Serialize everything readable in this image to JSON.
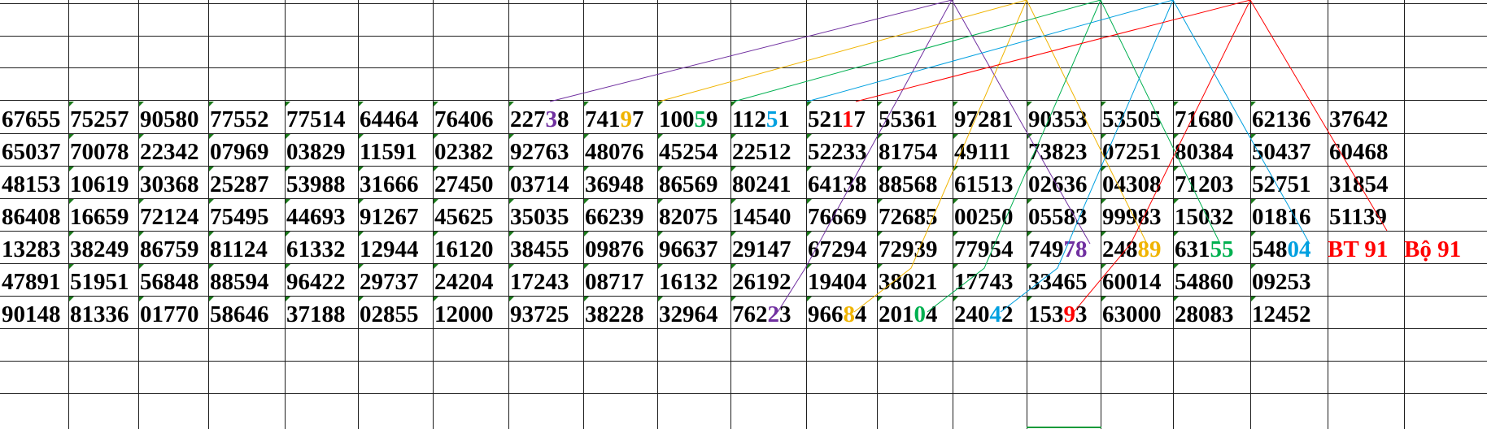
{
  "colors": {
    "black": "#000000",
    "purple": "#7030a0",
    "gold": "#f0b400",
    "green": "#00b050",
    "blue": "#00a0e0",
    "red": "#ff0000"
  },
  "rows": [
    [
      [
        {
          "t": "67655"
        }
      ],
      [
        {
          "t": "75257"
        }
      ],
      [
        {
          "t": "90580"
        }
      ],
      [
        {
          "t": "77552"
        }
      ],
      [
        {
          "t": "77514"
        }
      ],
      [
        {
          "t": "64464"
        }
      ],
      [
        {
          "t": "76406"
        }
      ],
      [
        {
          "t": "227"
        },
        {
          "t": "3",
          "c": "purple"
        },
        {
          "t": "8"
        }
      ],
      [
        {
          "t": "741"
        },
        {
          "t": "9",
          "c": "gold"
        },
        {
          "t": "7"
        }
      ],
      [
        {
          "t": "100"
        },
        {
          "t": "5",
          "c": "green"
        },
        {
          "t": "9"
        }
      ],
      [
        {
          "t": "112"
        },
        {
          "t": "5",
          "c": "blue"
        },
        {
          "t": "1"
        }
      ],
      [
        {
          "t": "521"
        },
        {
          "t": "1",
          "c": "red"
        },
        {
          "t": "7"
        }
      ],
      [
        {
          "t": "55361"
        }
      ],
      [
        {
          "t": "97281"
        }
      ],
      [
        {
          "t": "90353"
        }
      ],
      [
        {
          "t": "53505"
        }
      ],
      [
        {
          "t": "71680"
        }
      ],
      [
        {
          "t": "62136"
        }
      ],
      [
        {
          "t": "37642"
        }
      ]
    ],
    [
      [
        {
          "t": "65037"
        }
      ],
      [
        {
          "t": "70078"
        }
      ],
      [
        {
          "t": "22342"
        }
      ],
      [
        {
          "t": "07969"
        }
      ],
      [
        {
          "t": "03829"
        }
      ],
      [
        {
          "t": "11591"
        }
      ],
      [
        {
          "t": "02382"
        }
      ],
      [
        {
          "t": "92763"
        }
      ],
      [
        {
          "t": "48076"
        }
      ],
      [
        {
          "t": "45254"
        }
      ],
      [
        {
          "t": "22512"
        }
      ],
      [
        {
          "t": "52233"
        }
      ],
      [
        {
          "t": "81754"
        }
      ],
      [
        {
          "t": "49111"
        }
      ],
      [
        {
          "t": "73823"
        }
      ],
      [
        {
          "t": "07251"
        }
      ],
      [
        {
          "t": "80384"
        }
      ],
      [
        {
          "t": "50437"
        }
      ],
      [
        {
          "t": "60468"
        }
      ]
    ],
    [
      [
        {
          "t": "48153"
        }
      ],
      [
        {
          "t": "10619"
        }
      ],
      [
        {
          "t": "30368"
        }
      ],
      [
        {
          "t": "25287"
        }
      ],
      [
        {
          "t": "53988"
        }
      ],
      [
        {
          "t": "31666"
        }
      ],
      [
        {
          "t": "27450"
        }
      ],
      [
        {
          "t": "03714"
        }
      ],
      [
        {
          "t": "36948"
        }
      ],
      [
        {
          "t": "86569"
        }
      ],
      [
        {
          "t": "80241"
        }
      ],
      [
        {
          "t": "64138"
        }
      ],
      [
        {
          "t": "88568"
        }
      ],
      [
        {
          "t": "61513"
        }
      ],
      [
        {
          "t": "02636"
        }
      ],
      [
        {
          "t": "04308"
        }
      ],
      [
        {
          "t": "71203"
        }
      ],
      [
        {
          "t": "52751"
        }
      ],
      [
        {
          "t": "31854"
        }
      ]
    ],
    [
      [
        {
          "t": "86408"
        }
      ],
      [
        {
          "t": "16659"
        }
      ],
      [
        {
          "t": "72124"
        }
      ],
      [
        {
          "t": "75495"
        }
      ],
      [
        {
          "t": "44693"
        }
      ],
      [
        {
          "t": "91267"
        }
      ],
      [
        {
          "t": "45625"
        }
      ],
      [
        {
          "t": "35035"
        }
      ],
      [
        {
          "t": "66239"
        }
      ],
      [
        {
          "t": "82075"
        }
      ],
      [
        {
          "t": "14540"
        }
      ],
      [
        {
          "t": "76669"
        }
      ],
      [
        {
          "t": "72685"
        }
      ],
      [
        {
          "t": "00250"
        }
      ],
      [
        {
          "t": "05583"
        }
      ],
      [
        {
          "t": "99983"
        }
      ],
      [
        {
          "t": "15032"
        }
      ],
      [
        {
          "t": "01816"
        }
      ],
      [
        {
          "t": "51139"
        }
      ]
    ],
    [
      [
        {
          "t": "13283"
        }
      ],
      [
        {
          "t": "38249"
        }
      ],
      [
        {
          "t": "86759"
        }
      ],
      [
        {
          "t": "81124"
        }
      ],
      [
        {
          "t": "61332"
        }
      ],
      [
        {
          "t": "12944"
        }
      ],
      [
        {
          "t": "16120"
        }
      ],
      [
        {
          "t": "38455"
        }
      ],
      [
        {
          "t": "09876"
        }
      ],
      [
        {
          "t": "96637"
        }
      ],
      [
        {
          "t": "29147"
        }
      ],
      [
        {
          "t": "67294"
        }
      ],
      [
        {
          "t": "72939"
        }
      ],
      [
        {
          "t": "77954"
        }
      ],
      [
        {
          "t": "749"
        },
        {
          "t": "78",
          "c": "purple"
        }
      ],
      [
        {
          "t": "248"
        },
        {
          "t": "89",
          "c": "gold"
        }
      ],
      [
        {
          "t": "631"
        },
        {
          "t": "55",
          "c": "green"
        }
      ],
      [
        {
          "t": "548"
        },
        {
          "t": "04",
          "c": "blue"
        }
      ]
    ],
    [
      [
        {
          "t": "47891"
        }
      ],
      [
        {
          "t": "51951"
        }
      ],
      [
        {
          "t": "56848"
        }
      ],
      [
        {
          "t": "88594"
        }
      ],
      [
        {
          "t": "96422"
        }
      ],
      [
        {
          "t": "29737"
        }
      ],
      [
        {
          "t": "24204"
        }
      ],
      [
        {
          "t": "17243"
        }
      ],
      [
        {
          "t": "08717"
        }
      ],
      [
        {
          "t": "16132"
        }
      ],
      [
        {
          "t": "26192"
        }
      ],
      [
        {
          "t": "19404"
        }
      ],
      [
        {
          "t": "38021"
        }
      ],
      [
        {
          "t": "17743"
        }
      ],
      [
        {
          "t": "33465"
        }
      ],
      [
        {
          "t": "60014"
        }
      ],
      [
        {
          "t": "54860"
        }
      ],
      [
        {
          "t": "09253"
        }
      ]
    ],
    [
      [
        {
          "t": "90148"
        }
      ],
      [
        {
          "t": "81336"
        }
      ],
      [
        {
          "t": "01770"
        }
      ],
      [
        {
          "t": "58646"
        }
      ],
      [
        {
          "t": "37188"
        }
      ],
      [
        {
          "t": "02855"
        }
      ],
      [
        {
          "t": "12000"
        }
      ],
      [
        {
          "t": "93725"
        }
      ],
      [
        {
          "t": "38228"
        }
      ],
      [
        {
          "t": "32964"
        }
      ],
      [
        {
          "t": "762"
        },
        {
          "t": "2",
          "c": "purple"
        },
        {
          "t": "3"
        }
      ],
      [
        {
          "t": "966"
        },
        {
          "t": "8",
          "c": "gold"
        },
        {
          "t": "4"
        }
      ],
      [
        {
          "t": "201"
        },
        {
          "t": "0",
          "c": "green"
        },
        {
          "t": "4"
        }
      ],
      [
        {
          "t": "240"
        },
        {
          "t": "4",
          "c": "blue"
        },
        {
          "t": "2"
        }
      ],
      [
        {
          "t": "153"
        },
        {
          "t": "9",
          "c": "red"
        },
        {
          "t": "3"
        }
      ],
      [
        {
          "t": "63000"
        }
      ],
      [
        {
          "t": "28083"
        }
      ],
      [
        {
          "t": "12452"
        }
      ]
    ]
  ],
  "notes": {
    "bt": "BT 91",
    "bo": "Bộ 91"
  }
}
